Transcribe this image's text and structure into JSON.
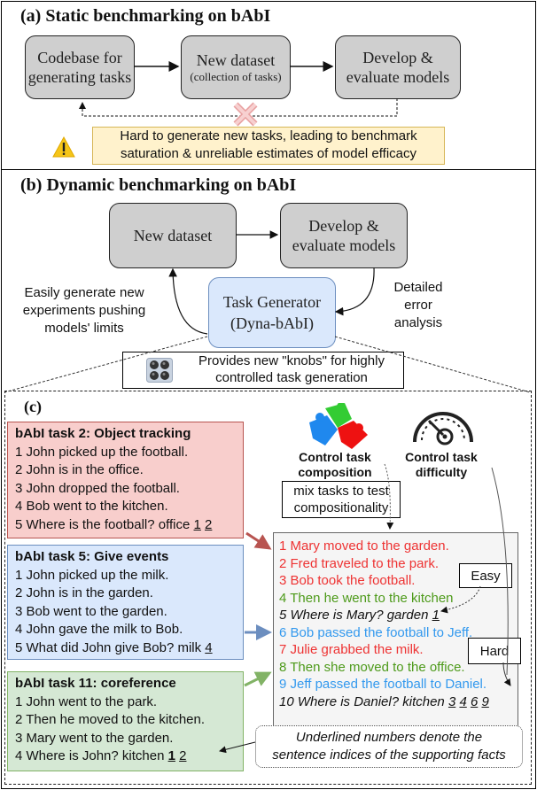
{
  "section_a": {
    "title": "(a) Static benchmarking on bAbI",
    "box1": {
      "line1": "Codebase for",
      "line2": "generating tasks"
    },
    "box2": {
      "line1": "New dataset",
      "line2": "(collection of tasks)"
    },
    "box3": {
      "line1": "Develop &",
      "line2": "evaluate models"
    },
    "warning": {
      "icon": "warning-triangle-icon",
      "line1": "Hard to generate new tasks, leading to benchmark",
      "line2": "saturation & unreliable estimates of model efficacy"
    },
    "blocked_icon": "cross-icon"
  },
  "section_b": {
    "title": "(b) Dynamic benchmarking on bAbI",
    "box_dataset": "New dataset",
    "box_models": {
      "line1": "Develop &",
      "line2": "evaluate models"
    },
    "generator": {
      "line1": "Task Generator",
      "line2": "(Dyna-bAbI)"
    },
    "left_caption": [
      "Easily generate new",
      "experiments pushing",
      "models' limits"
    ],
    "right_caption": [
      "Detailed",
      "error",
      "analysis"
    ],
    "knobs": {
      "icon": "knobs-icon",
      "line1": "Provides new \"knobs\" for highly",
      "line2": "controlled task generation"
    }
  },
  "section_c": {
    "title": "(c)",
    "tasks": [
      {
        "title": "bAbI task 2: Object tracking",
        "lines": [
          "1 John picked up the football.",
          "2 John is in the office.",
          "3 John dropped the football.",
          "4 Bob went to the kitchen."
        ],
        "question": "5 Where is the football? office ",
        "supports": [
          "1",
          "2"
        ],
        "color": "#f8cecc"
      },
      {
        "title": "bAbI task 5: Give events",
        "lines": [
          "1 John picked up the milk.",
          "2 John is in the garden.",
          "3 Bob went to the garden.",
          "4 John gave the milk to Bob."
        ],
        "question": "5 What did John give Bob? milk ",
        "supports": [
          "4"
        ],
        "color": "#dae8fc"
      },
      {
        "title": "bAbI task 11: coreference",
        "lines": [
          "1 John went to the park.",
          "2 Then he moved to the kitchen.",
          "3 Mary went to the garden."
        ],
        "question": "4 Where is John? kitchen ",
        "supports": [
          "1",
          "2"
        ],
        "color": "#d5e8d4"
      }
    ],
    "composition": {
      "icon": "puzzle-icon",
      "line1": "Control task",
      "line2": "composition"
    },
    "difficulty": {
      "icon": "speedometer-icon",
      "line1": "Control task",
      "line2": "difficulty"
    },
    "mix_note": {
      "line1": "mix tasks to test",
      "line2": "compositionality"
    },
    "story": [
      {
        "text": "1 Mary moved to the garden.",
        "color": "#ee3333"
      },
      {
        "text": "2 Fred traveled to the park.",
        "color": "#ee3333"
      },
      {
        "text": "3 Bob took the football.",
        "color": "#ee3333"
      },
      {
        "text": "4 Then he went to the kitchen",
        "color": "#4d9a1a"
      },
      {
        "text": "5 Where is Mary? garden ",
        "supports": [
          "1"
        ],
        "color": "#111111",
        "italic": true
      },
      {
        "text": "6 Bob passed the football to Jeff.",
        "color": "#3399ee"
      },
      {
        "text": "7 Julie grabbed the milk.",
        "color": "#ee3333"
      },
      {
        "text": "8 Then she moved to the office.",
        "color": "#4d9a1a"
      },
      {
        "text": "9 Jeff passed the football to Daniel.",
        "color": "#3399ee"
      },
      {
        "text": "10 Where is Daniel? kitchen ",
        "supports": [
          "3",
          "4",
          "6",
          "9"
        ],
        "color": "#111111",
        "italic": true
      }
    ],
    "easy_label": "Easy",
    "hard_label": "Hard",
    "footnote": {
      "line1": "Underlined numbers denote the",
      "line2": "sentence indices of the supporting facts"
    }
  }
}
